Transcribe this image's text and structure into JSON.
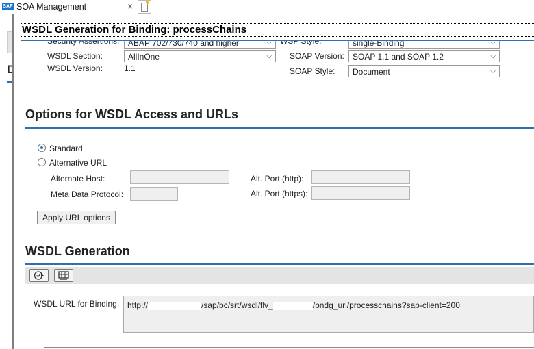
{
  "tab": {
    "title": "SOA Management",
    "logo": "SAP",
    "close": "×"
  },
  "left_panel": {
    "letter": "D"
  },
  "dialog": {
    "title": "WSDL Generation for Binding: processChains"
  },
  "top_settings": {
    "security_label": "Security Assertions:",
    "security_value": "ABAP 702/730/740 and higher",
    "wsdl_section_label": "WSDL Section:",
    "wsdl_section_value": "AllInOne",
    "wsdl_version_label": "WSDL Version:",
    "wsdl_version_value": "1.1",
    "wsp_style_label": "WSP Style:",
    "wsp_style_value": "single-Binding",
    "soap_version_label": "SOAP Version:",
    "soap_version_value": "SOAP 1.1 and SOAP 1.2",
    "soap_style_label": "SOAP Style:",
    "soap_style_value": "Document"
  },
  "access": {
    "heading": "Options for WSDL Access and URLs",
    "radio_standard": "Standard",
    "radio_alt_url": "Alternative URL",
    "selected": "Standard",
    "alt_host_label": "Alternate Host:",
    "meta_protocol_label": "Meta Data Protocol:",
    "alt_port_http_label": "Alt. Port (http):",
    "alt_port_https_label": "Alt. Port (https):",
    "apply_button": "Apply URL options"
  },
  "generation": {
    "heading": "WSDL Generation",
    "toolbar_icons": [
      "execute-icon",
      "display-icon"
    ],
    "url_label": "WSDL URL for Binding:",
    "url_part1": "http://",
    "url_part2": "/sap/bc/srt/wsdl/flv_",
    "url_part3": "/bndg_url/processchains?sap-client=200"
  },
  "colors": {
    "accent": "#2f6fb0",
    "brand": "#1b74c5"
  }
}
